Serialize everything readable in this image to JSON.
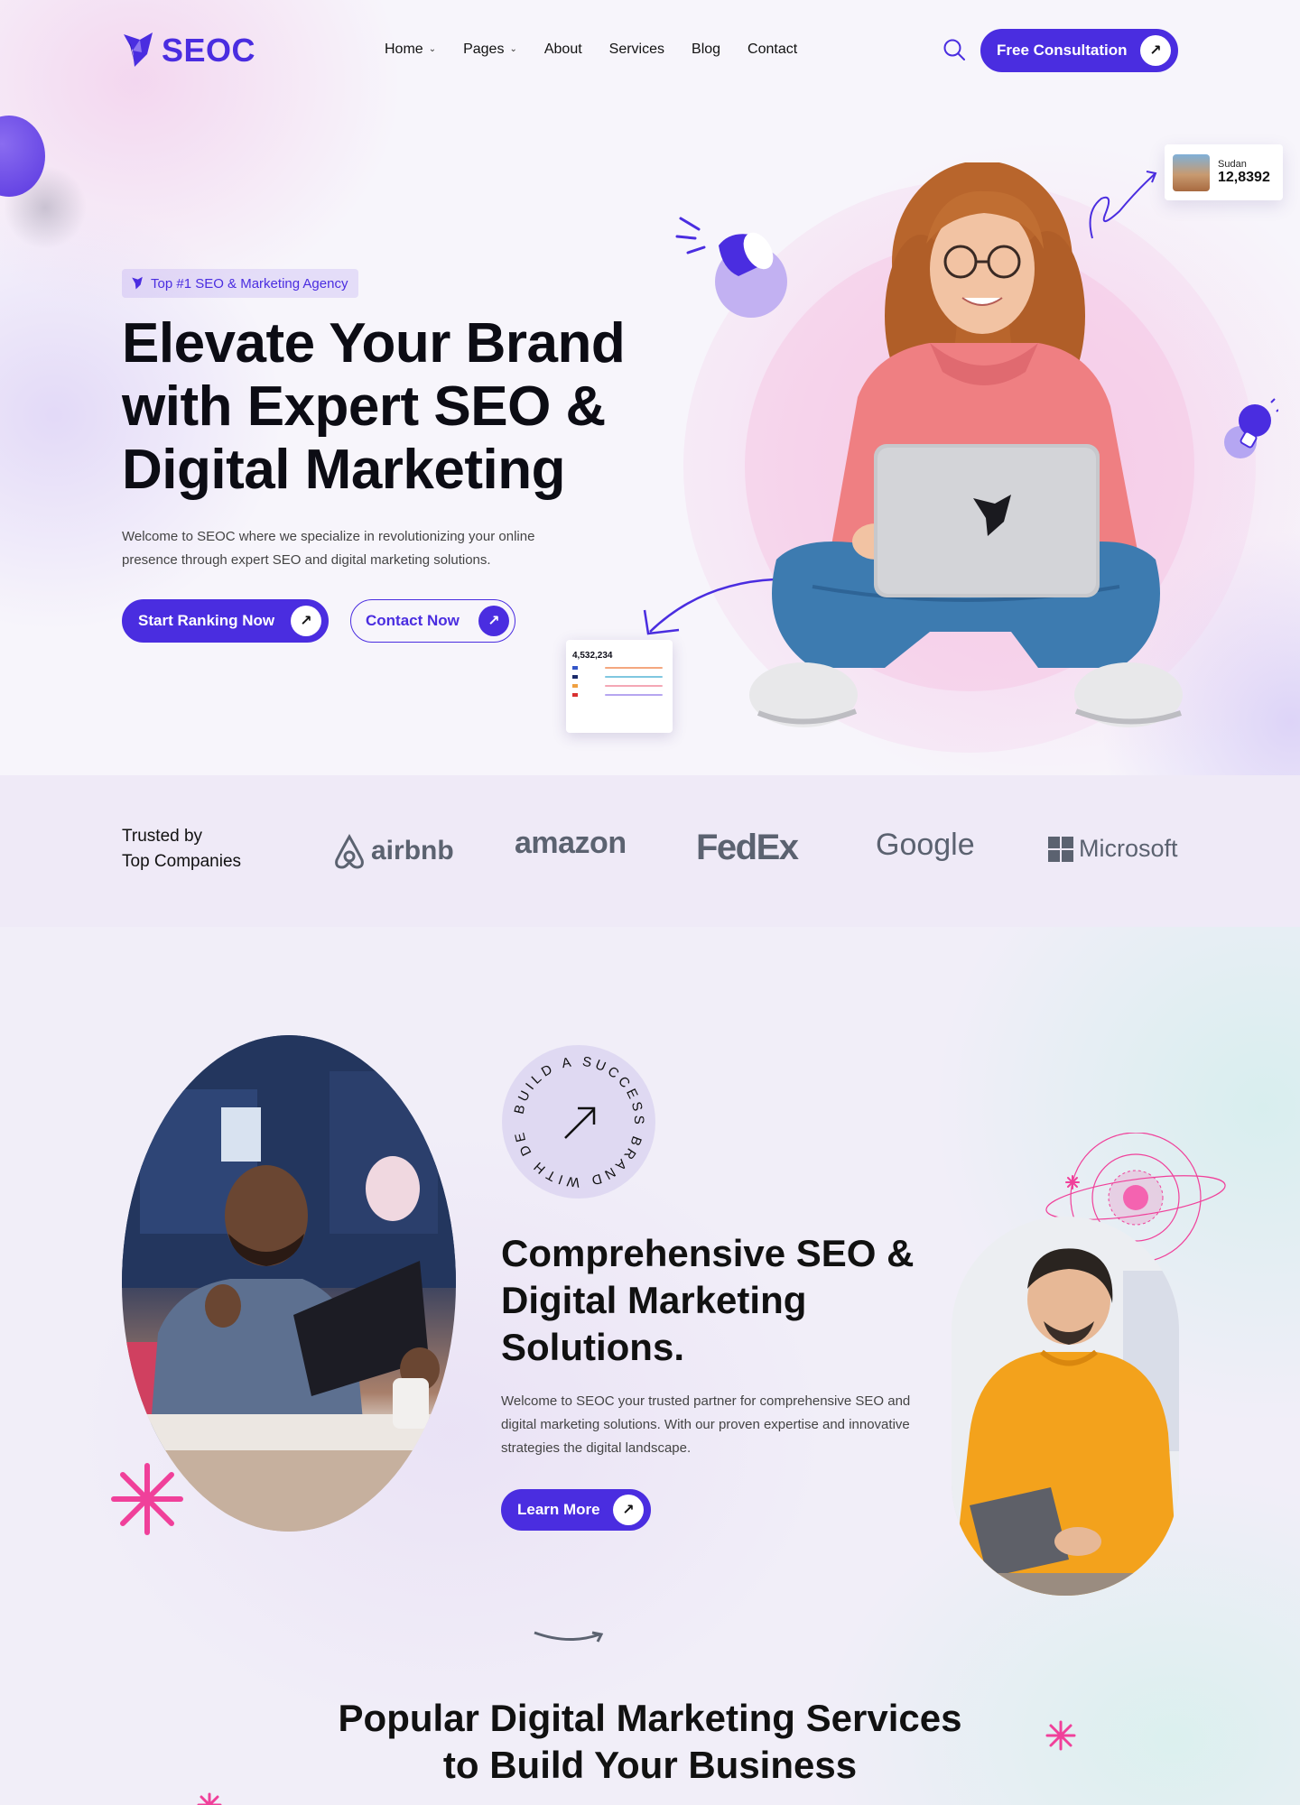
{
  "header": {
    "logo_text": "SEOC",
    "nav": [
      {
        "label": "Home",
        "has_dropdown": true
      },
      {
        "label": "Pages",
        "has_dropdown": true
      },
      {
        "label": "About",
        "has_dropdown": false
      },
      {
        "label": "Services",
        "has_dropdown": false
      },
      {
        "label": "Blog",
        "has_dropdown": false
      },
      {
        "label": "Contact",
        "has_dropdown": false
      }
    ],
    "cta_label": "Free Consultation"
  },
  "hero": {
    "tag": "Top #1 SEO & Marketing Agency",
    "title": "Elevate Your Brand with Expert SEO & Digital Marketing",
    "description": "Welcome to SEOC where we specialize in revolutionizing your online presence through expert SEO and digital marketing solutions.",
    "primary_cta": "Start Ranking Now",
    "secondary_cta": "Contact Now",
    "stat_card": {
      "label": "Sudan",
      "value": "12,8392"
    },
    "mini_dashboard": {
      "value": "4,532,234"
    }
  },
  "trusted": {
    "title_line1": "Trusted by",
    "title_line2": "Top Companies",
    "brands": [
      "airbnb",
      "amazon",
      "FedEx",
      "Google",
      "Microsoft"
    ]
  },
  "about": {
    "badge_text": "BUILD A SUCCESS BRAND WITH DEMOUI",
    "title": "Comprehensive SEO & Digital Marketing Solutions.",
    "description": "Welcome to SEOC your trusted partner for comprehensive SEO and digital marketing solutions. With our proven expertise and innovative strategies the digital landscape.",
    "cta": "Learn More"
  },
  "services": {
    "title_line1": "Popular Digital Marketing Services",
    "title_line2": "to Build Your Business"
  },
  "colors": {
    "brand": "#4a2de0",
    "accent_pink": "#f0409a"
  }
}
